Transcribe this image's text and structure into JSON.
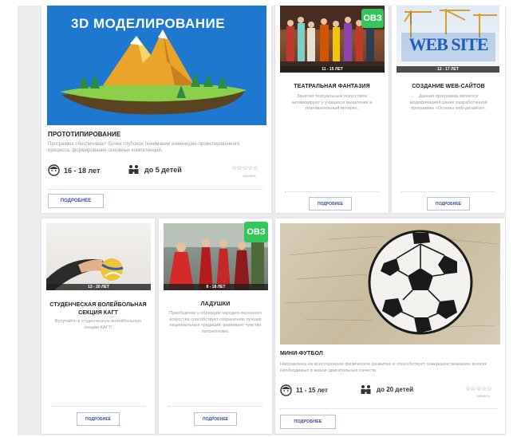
{
  "cards": {
    "modeling": {
      "banner_text": "3D МОДЕЛИРОВАНИЕ",
      "title": "ПРОТОТИПИРОВАНИЕ",
      "desc": "Программа обеспечивает более глубокое понимание инженерно-проектировочного процесса, формирование основных компетенций.",
      "age": "16 - 18 лет",
      "capacity": "до 5 детей",
      "rating_label": "оценить",
      "button": "ПОДРОБНЕЕ"
    },
    "theater": {
      "badge": "ОВЗ",
      "age_badge": "11 - 15 ЛЕТ",
      "title": "ТЕАТРАЛЬНАЯ ФАНТАЗИЯ",
      "desc": "Занятия театральным искусством активизируют у учащихся мышление и познавательный интерес.",
      "button": "ПОДРОБНЕЕ"
    },
    "web": {
      "banner_text": "WEB SITE",
      "age_badge": "12 - 17 ЛЕТ",
      "title": "СОЗДАНИЕ WEB-САЙТОВ",
      "desc": "Данная программа является модификацией ранее разработанной программы «Основы web-дизайна».",
      "button": "ПОДРОБНЕЕ"
    },
    "volley": {
      "age_badge": "13 - 20 ЛЕТ",
      "title": "СТУДЕНЧЕСКАЯ ВОЛЕЙБОЛЬНАЯ СЕКЦИЯ КАГТ",
      "desc": "Вступайте в студенческую волейбольную секцию КАГТ!",
      "button": "ПОДРОБНЕЕ"
    },
    "ladushki": {
      "badge": "ОВЗ",
      "age_badge": "8 - 18 ЛЕТ",
      "title": "ЛАДУШКИ",
      "desc": "Приобщение к образцам народно-песенного искусства способствует сохранению лучших национальных традиций, развивает чувство патриотизма.",
      "button": "ПОДРОБНЕЕ"
    },
    "football": {
      "title": "МИНИ-ФУТБОЛ",
      "desc": "Направлена на всестороннее физическое развитие и способствует совершенствованию многих необходимых в жизни двигательных качеств.",
      "age": "11 - 15 лет",
      "capacity": "до 20 детей",
      "rating_label": "оценить",
      "button": "ПОДРОБНЕЕ"
    }
  },
  "colors": {
    "accent_blue": "#1976c9",
    "ovz_green": "#33c65b",
    "button_text": "#3a4aa8"
  }
}
